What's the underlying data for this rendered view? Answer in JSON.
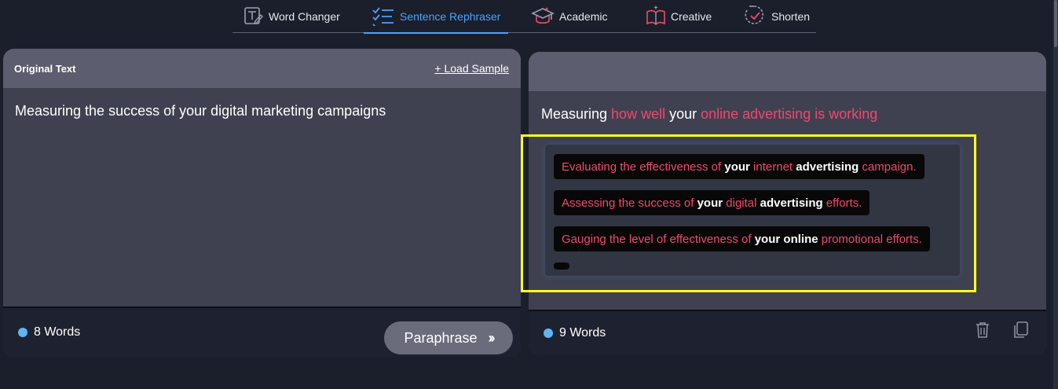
{
  "modes": [
    {
      "label": "Word Changer",
      "icon": "word-changer-icon"
    },
    {
      "label": "Sentence Rephraser",
      "icon": "sentence-rephraser-icon"
    },
    {
      "label": "Academic",
      "icon": "academic-cap-icon"
    },
    {
      "label": "Creative",
      "icon": "open-book-icon"
    },
    {
      "label": "Shorten",
      "icon": "shorten-icon"
    }
  ],
  "active_mode": "Sentence Rephraser",
  "input_panel": {
    "title": "Original Text",
    "load_sample": "+ Load Sample",
    "text": "Measuring the success of your digital marketing campaigns",
    "word_count": "8 Words",
    "paraphrase_label": "Paraphrase",
    "paraphrase_chevron": "››"
  },
  "output_panel": {
    "segments": [
      "Measuring ",
      "how well",
      " your ",
      "online advertising is working"
    ],
    "word_count": "9 Words",
    "suggestions": [
      {
        "parts": [
          "Evaluating the effectiveness of ",
          "your",
          " internet ",
          "advertising",
          " campaign."
        ]
      },
      {
        "parts": [
          "Assessing the success of ",
          "your",
          " digital ",
          "advertising",
          " efforts."
        ]
      },
      {
        "parts": [
          "Gauging the level of effectiveness of ",
          "your",
          " ",
          "online",
          " promotional efforts."
        ]
      }
    ]
  },
  "colors": {
    "accent_blue": "#4ea1ff",
    "highlight_red": "#f2476d",
    "annotation_yellow": "#ffff21",
    "count_dot": "#5fb4f5"
  }
}
